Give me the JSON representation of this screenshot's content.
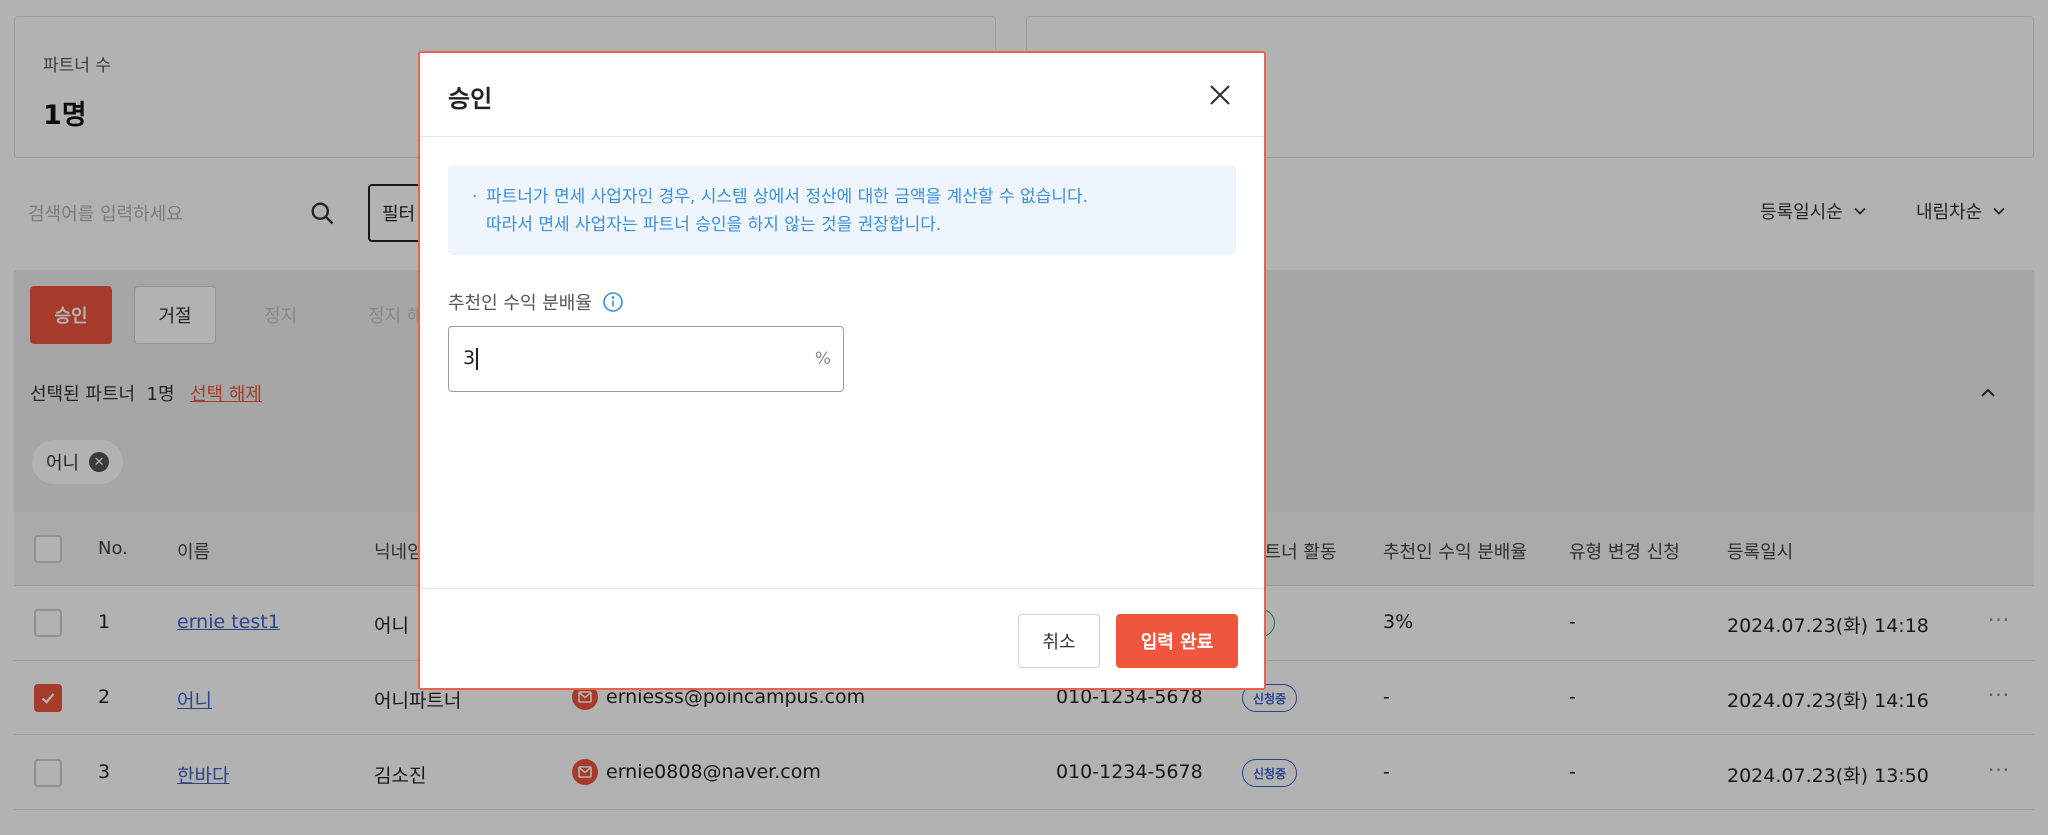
{
  "stats": [
    {
      "label": "파트너 수",
      "value": "1명"
    }
  ],
  "search": {
    "placeholder": "검색어를 입력하세요",
    "icon": "search-icon"
  },
  "filter": {
    "label": "필터"
  },
  "sort": {
    "order_by": "등록일시순",
    "direction": "내림차순"
  },
  "actions": {
    "approve": "승인",
    "reject": "거절",
    "suspend": "정지",
    "unsuspend": "정지 해"
  },
  "selection": {
    "text": "선택된 파트너",
    "count": "1명",
    "clear": "선택 해제",
    "chips": [
      "어니"
    ]
  },
  "table": {
    "headers": {
      "no": "No.",
      "name": "이름",
      "nickname": "닉네임",
      "activity": "파트너 활동",
      "rate": "추천인 수익 분배율",
      "type_change": "유형 변경 신청",
      "registered": "등록일시"
    },
    "rows": [
      {
        "checked": false,
        "no": "1",
        "name": "ernie test1",
        "nickname": "어니",
        "email": "",
        "phone": "",
        "status": "인",
        "rate": "3%",
        "type_change": "-",
        "registered": "2024.07.23(화) 14:18"
      },
      {
        "checked": true,
        "no": "2",
        "name": "어니",
        "nickname": "어니파트너",
        "email": "erniesss@poincampus.com",
        "phone": "010-1234-5678",
        "status": "신청중",
        "rate": "-",
        "type_change": "-",
        "registered": "2024.07.23(화) 14:16"
      },
      {
        "checked": false,
        "no": "3",
        "name": "한바다",
        "nickname": "김소진",
        "email": "ernie0808@naver.com",
        "phone": "010-1234-5678",
        "status": "신청중",
        "rate": "-",
        "type_change": "-",
        "registered": "2024.07.23(화) 13:50"
      }
    ],
    "more": "···"
  },
  "modal": {
    "title": "승인",
    "notice_bullet": "·",
    "notice_line1": "파트너가 면세 사업자인 경우, 시스템 상에서 정산에 대한 금액을 계산할 수 없습니다.",
    "notice_line2": "따라서 면세 사업자는 파트너 승인을 하지 않는 것을 권장합니다.",
    "field_label": "추천인 수익 분배율",
    "field_value": "3",
    "field_unit": "%",
    "cancel": "취소",
    "submit": "입력 완료"
  },
  "colors": {
    "accent": "#f0553e",
    "link": "#3d64c8",
    "notice_text": "#3b8fdb",
    "notice_bg": "#eef5fd"
  }
}
